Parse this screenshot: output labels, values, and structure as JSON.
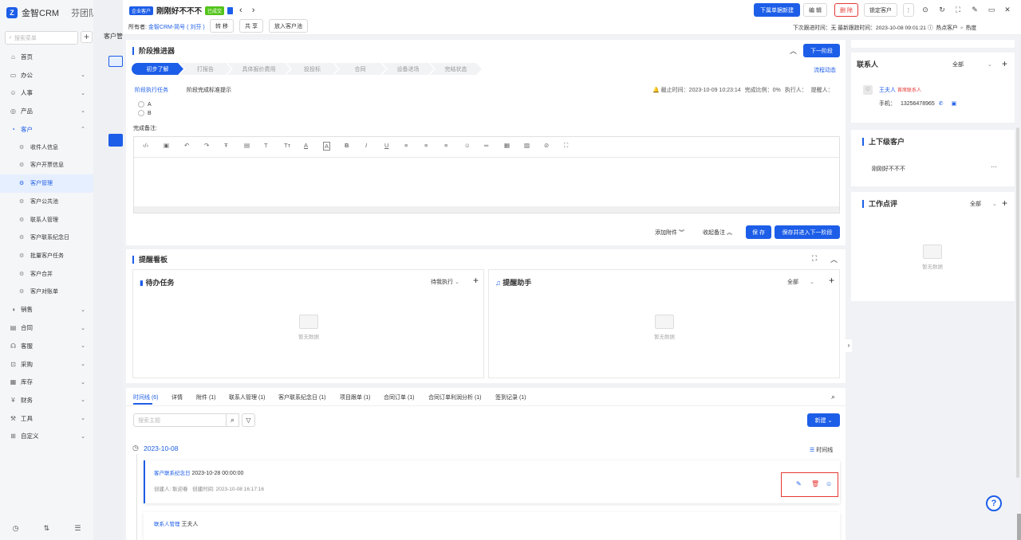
{
  "app": {
    "brand": "金智CRM",
    "team": "芬团队"
  },
  "sidebar": {
    "search_placeholder": "搜索菜单",
    "items": [
      {
        "icon": "home-icon",
        "label": "首页"
      },
      {
        "icon": "office-icon",
        "label": "办公"
      },
      {
        "icon": "person-icon",
        "label": "人事"
      },
      {
        "icon": "product-icon",
        "label": "产品"
      },
      {
        "icon": "customer-icon",
        "label": "客户"
      }
    ],
    "sub_items": [
      "收件人信息",
      "客户开票信息",
      "客户管理",
      "客户公共池",
      "联系人管理",
      "客户联系纪念日",
      "批量客户任务",
      "客户合并",
      "客户对账单"
    ],
    "items_after": [
      {
        "icon": "sales-icon",
        "label": "销售"
      },
      {
        "icon": "contract-icon",
        "label": "合同"
      },
      {
        "icon": "service-icon",
        "label": "客服"
      },
      {
        "icon": "purchase-icon",
        "label": "采购"
      },
      {
        "icon": "inventory-icon",
        "label": "库存"
      },
      {
        "icon": "finance-icon",
        "label": "财务"
      },
      {
        "icon": "tools-icon",
        "label": "工具"
      },
      {
        "icon": "custom-icon",
        "label": "自定义"
      }
    ]
  },
  "peek": {
    "title": "客户管"
  },
  "header": {
    "tag": "企业客户",
    "name": "刚刚好不不不",
    "status": "已成交",
    "owner_label": "所有者:",
    "owner_value": "金智CRM-简号 ( 刘芬 )",
    "actions": [
      "转 移",
      "共 享",
      "放入客户池"
    ],
    "buttons": {
      "new_order": "下属单据新建",
      "edit": "编 辑",
      "delete": "删 除",
      "lock": "锁定客户"
    },
    "next_followup": "下次跟进时间：无",
    "last_followup": "最新跟踪时间：2023-10-08 09:01:21",
    "hot_label": "热点客户",
    "heat_label": "热度"
  },
  "stage_panel": {
    "title": "阶段推进器",
    "next_button": "下一阶段",
    "flow_link": "流程动态",
    "stages": [
      "初步了解",
      "打报告",
      "具体报价费用",
      "投投标",
      "合同",
      "设备进场",
      "完结状态"
    ],
    "task_label": "阶段执行任务",
    "standard_label": "阶段完成标准提示",
    "deadline": "截止时间：2023-10-09 10:23:14",
    "ratio": "完成比例：0%",
    "executor": "执行人：",
    "reminder": "提醒人：",
    "checklist": [
      "A",
      "B"
    ],
    "remark_label": "完成备注:",
    "add_attachment": "添加附件",
    "collapse_remark": "收起备注",
    "save": "保 存",
    "save_next": "保存并进入下一阶段"
  },
  "board": {
    "title": "提醒看板",
    "todo": {
      "title": "待办任务",
      "filter": "待我执行",
      "empty": "暂无数据"
    },
    "assistant": {
      "title": "提醒助手",
      "filter": "全部",
      "empty": "暂无数据"
    }
  },
  "tabs": [
    "时间线 (6)",
    "详情",
    "附件 (1)",
    "联系人管理 (1)",
    "客户联系纪念日 (1)",
    "项目跟单 (1)",
    "合同订单 (1)",
    "合同订单利润分析 (1)",
    "签到记录 (1)"
  ],
  "timeline": {
    "search_placeholder": "搜索主题",
    "new_button": "新建",
    "date": "2023-10-08",
    "view_label": "时间线",
    "entries": [
      {
        "type": "客户联系纪念日",
        "value": "2023-10-28 00:00:00",
        "creator": "创建人: 耿迎春",
        "created": "创建时间: 2023-10-08 16:17:16"
      },
      {
        "type": "联系人管理",
        "value": "王夫人"
      }
    ]
  },
  "right": {
    "contacts": {
      "title": "联系人",
      "filter": "全部",
      "name": "王夫人",
      "tag": "首席联系人",
      "phone_label": "手机：",
      "phone": "13256478965"
    },
    "parent": {
      "title": "上下级客户",
      "item": "刚刚好不不不",
      "more": "···"
    },
    "review": {
      "title": "工作点评",
      "filter": "全部",
      "empty": "暂无数据"
    }
  },
  "colors": {
    "primary": "#1d5ee8",
    "success": "#52c41a",
    "danger": "#e53935"
  }
}
